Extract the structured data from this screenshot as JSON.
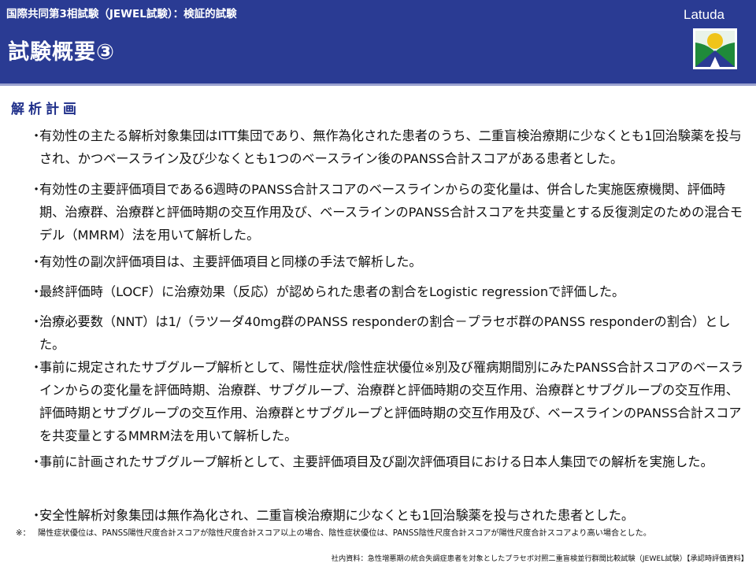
{
  "header": {
    "subtitle": "国際共同第3相試験（JEWEL試験）：検証的試験",
    "title": "試験概要③",
    "logo_text": "Latuda"
  },
  "section": {
    "heading": "解析計画"
  },
  "bullets": [
    {
      "dot": "・",
      "text": "有効性の主たる解析対象集団はITT集団であり、無作為化された患者のうち、二重盲検治療期に少なくとも1回治験薬を投与され、かつベースライン及び少なくとも1つのベースライン後のPANSS合計スコアがある患者とした。"
    },
    {
      "dot": "・",
      "text": "有効性の主要評価項目である6週時のPANSS合計スコアのベースラインからの変化量は、併合した実施医療機関、評価時期、治療群、治療群と評価時期の交互作用及び、ベースラインのPANSS合計スコアを共変量とする反復測定のための混合モデル（MMRM）法を用いて解析した。"
    },
    {
      "dot": "・",
      "text": "有効性の副次評価項目は、主要評価項目と同様の手法で解析した。"
    },
    {
      "dot": "・",
      "text": "最終評価時（LOCF）に治療効果（反応）が認められた患者の割合をLogistic regressionで評価した。"
    },
    {
      "dot": "・",
      "text": "治療必要数（NNT）は1/（ラツーダ40mg群のPANSS responderの割合－プラセボ群のPANSS responderの割合）とした。"
    },
    {
      "dot": "・",
      "text": "事前に規定されたサブグループ解析として、陽性症状/陰性症状優位※別及び罹病期間別にみたPANSS合計スコアのベースラインからの変化量を評価時期、治療群、サブグループ、治療群と評価時期の交互作用、治療群とサブグループの交互作用、評価時期とサブグループの交互作用、治療群とサブグループと評価時期の交互作用及び、ベースラインのPANSS合計スコアを共変量とするMMRM法を用いて解析した。"
    },
    {
      "dot": "・",
      "text": "事前に計画されたサブグループ解析として、主要評価項目及び副次評価項目における日本人集団での解析を実施した。"
    },
    {
      "dot": "・",
      "text": "安全性解析対象集団は無作為化され、二重盲検治療期に少なくとも1回治験薬を投与された患者とした。"
    }
  ],
  "footnote": {
    "mark": "※：",
    "text": "陽性症状優位は、PANSS陽性尺度合計スコアが陰性尺度合計スコア以上の場合、陰性症状優位は、PANSS陰性尺度合計スコアが陽性尺度合計スコアより高い場合とした。"
  },
  "source": "社内資料：急性増悪期の統合失調症患者を対象としたプラセボ対照二重盲検並行群間比較試験（JEWEL試験）【承認時評価資料】",
  "colors": {
    "header_bg": "#2a3b93",
    "heading": "#1f2f8a",
    "logo_green": "#1f8a3a",
    "logo_yellow": "#f0c419"
  }
}
